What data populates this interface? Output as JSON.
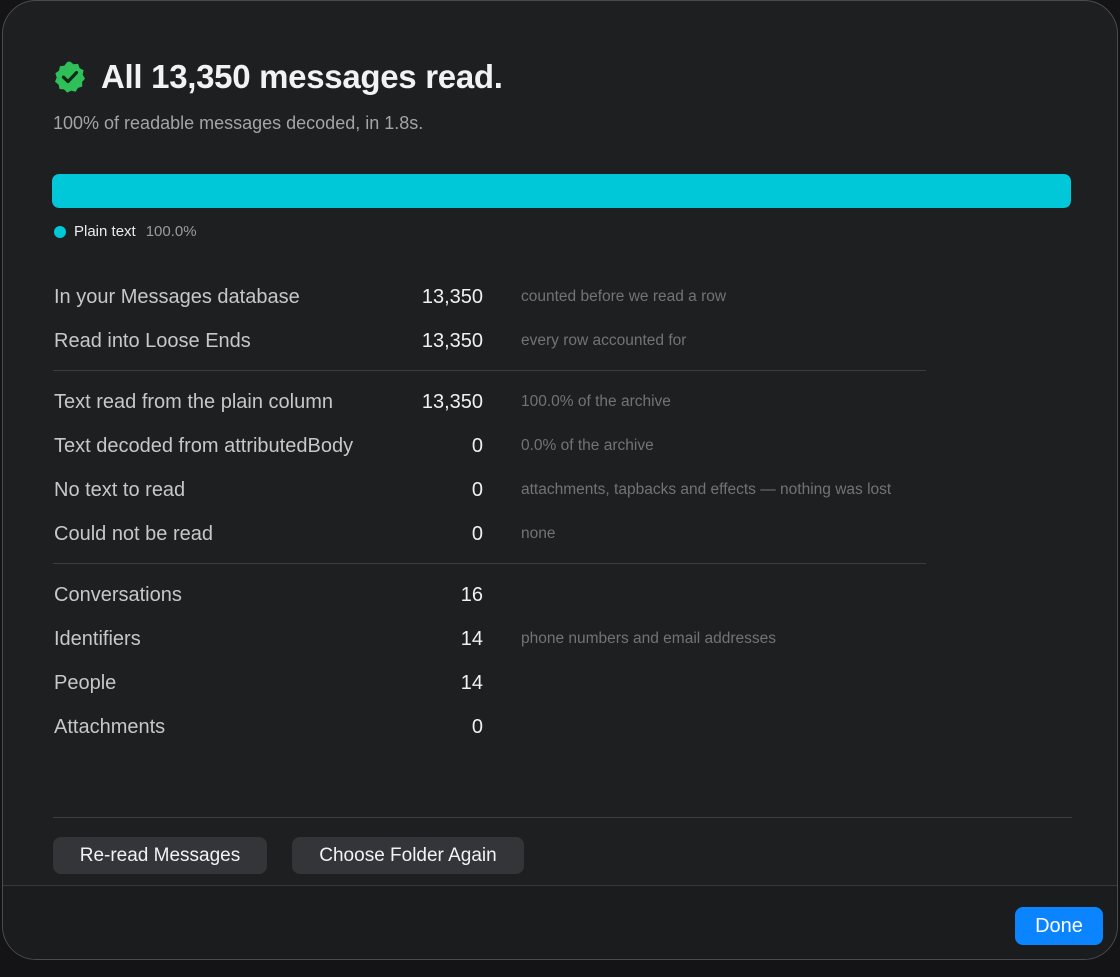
{
  "header": {
    "icon": "verified-check-badge-icon",
    "title": "All 13,350 messages read.",
    "subtitle": "100% of readable messages decoded, in 1.8s."
  },
  "progress": {
    "fraction": 1.0,
    "color": "#00c8d8",
    "legend": {
      "label": "Plain text",
      "value": "100.0%"
    }
  },
  "stats": {
    "groups": [
      [
        {
          "label": "In your Messages database",
          "value": "13,350",
          "note": "counted before we read a row"
        },
        {
          "label": "Read into Loose Ends",
          "value": "13,350",
          "note": "every row accounted for"
        }
      ],
      [
        {
          "label": "Text read from the plain column",
          "value": "13,350",
          "note": "100.0% of the archive"
        },
        {
          "label": "Text decoded from attributedBody",
          "value": "0",
          "note": "0.0% of the archive"
        },
        {
          "label": "No text to read",
          "value": "0",
          "note": "attachments, tapbacks and effects — nothing was lost"
        },
        {
          "label": "Could not be read",
          "value": "0",
          "note": "none"
        }
      ],
      [
        {
          "label": "Conversations",
          "value": "16",
          "note": ""
        },
        {
          "label": "Identifiers",
          "value": "14",
          "note": "phone numbers and email addresses"
        },
        {
          "label": "People",
          "value": "14",
          "note": ""
        },
        {
          "label": "Attachments",
          "value": "0",
          "note": ""
        }
      ]
    ]
  },
  "actions": {
    "reread_label": "Re-read Messages",
    "choose_folder_label": "Choose Folder Again",
    "done_label": "Done"
  },
  "colors": {
    "accent": "#0a84ff",
    "badge": "#30c05a",
    "progress": "#00c8d8"
  }
}
